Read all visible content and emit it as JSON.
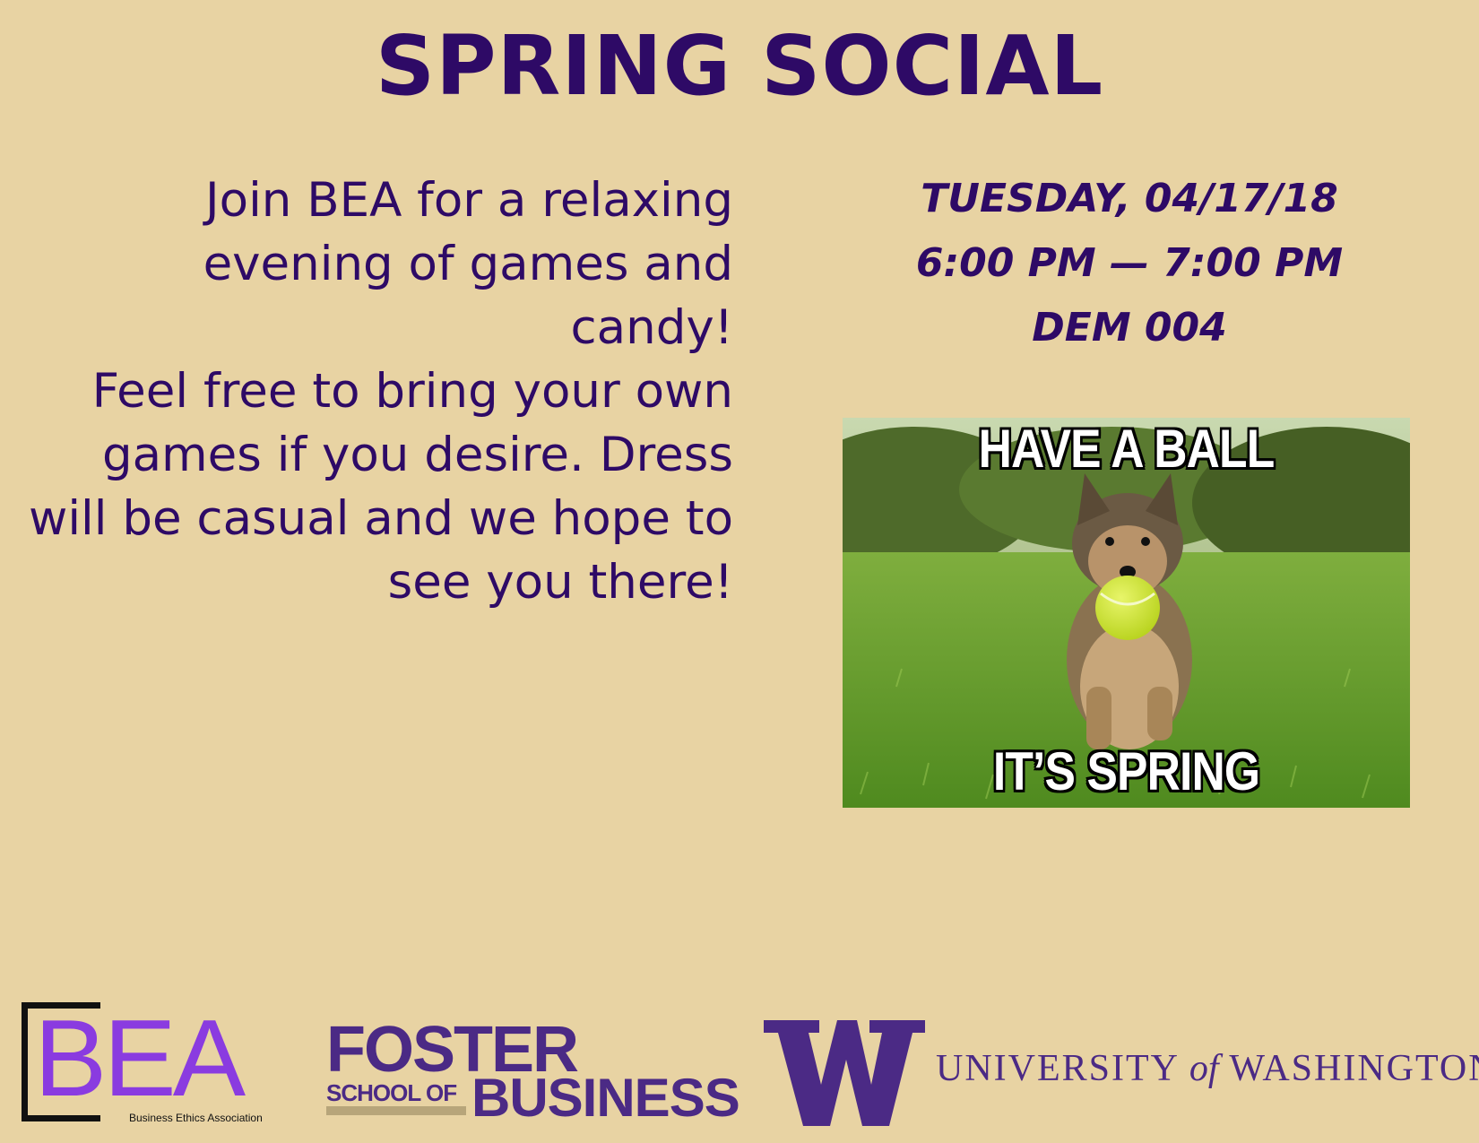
{
  "title": "SPRING SOCIAL",
  "description": [
    "Join BEA for a relaxing",
    "evening of games and candy!",
    "Feel free to bring your own",
    "games if you desire. Dress",
    "will be casual and we hope to",
    "see you there!"
  ],
  "event": {
    "date": "TUESDAY, 04/17/18",
    "time": "6:00 PM — 7:00 PM",
    "location": "DEM 004"
  },
  "meme": {
    "top_text": "HAVE A BALL",
    "bottom_text": "IT’S SPRING"
  },
  "logos": {
    "bea": {
      "letters": "BEA",
      "subtitle": "Business Ethics Association",
      "color": "#8a3be0"
    },
    "foster": {
      "line1": "FOSTER",
      "line2a": "SCHOOL OF",
      "line2b": "BUSINESS",
      "color": "#4b2a85",
      "accent": "#b7a57a"
    },
    "uw": {
      "mark": "W",
      "name_part1": "UNIVERSITY",
      "name_of": "of",
      "name_part2": "WASHINGTON",
      "color": "#4b2a85"
    }
  },
  "colors": {
    "background": "#e8d3a3",
    "text": "#2e0a66"
  }
}
